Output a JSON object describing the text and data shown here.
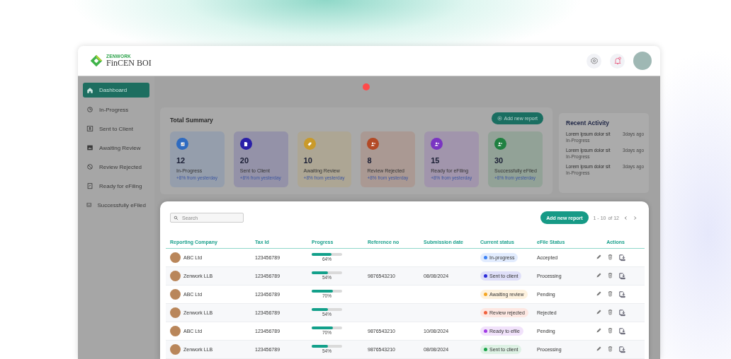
{
  "header": {
    "brand_tagline": "ZENWORK",
    "brand_name": "FinCEN BOI"
  },
  "sidebar": {
    "items": [
      {
        "label": "Dashboard",
        "selected": true
      },
      {
        "label": "In-Progress",
        "selected": false
      },
      {
        "label": "Sent to Client",
        "selected": false
      },
      {
        "label": "Awaiting Review",
        "selected": false
      },
      {
        "label": "Review Rejected",
        "selected": false
      },
      {
        "label": "Ready for eFiling",
        "selected": false
      },
      {
        "label": "Successfully eFiled",
        "selected": false
      }
    ]
  },
  "summary": {
    "title": "Total Summary",
    "add_button": "Add new report",
    "cards": [
      {
        "count": "12",
        "label": "In-Progress",
        "note": "+8% from yesterday",
        "color": "#2f6bc0"
      },
      {
        "count": "20",
        "label": "Sent to Client",
        "note": "+8% from yesterday",
        "color": "#2a1fa8"
      },
      {
        "count": "10",
        "label": "Awaiting Review",
        "note": "+8% from yesterday",
        "color": "#c99a2a"
      },
      {
        "count": "8",
        "label": "Review Rejected",
        "note": "+8% from yesterday",
        "color": "#b34a26"
      },
      {
        "count": "15",
        "label": "Ready for eFiling",
        "note": "+8% from yesterday",
        "color": "#7a34c2"
      },
      {
        "count": "30",
        "label": "Successfully eFiled",
        "note": "+8% from yesterday",
        "color": "#1f8040"
      }
    ]
  },
  "recent_activity": {
    "title": "Recent Activity",
    "items": [
      {
        "title": "Lorem Ipsum dolor sit",
        "status": "In-Progress",
        "time": "3days ago"
      },
      {
        "title": "Lorem Ipsum dolor sit",
        "status": "In-Progress",
        "time": "3days ago"
      },
      {
        "title": "Lorem Ipsum dolor sit",
        "status": "In-Progress",
        "time": "3days ago"
      }
    ]
  },
  "reports": {
    "search": {
      "placeholder": "Search"
    },
    "add_button": "Add new report",
    "range": "1 - 10",
    "total": "of 12",
    "columns": [
      "Reporting Company",
      "Tax Id",
      "Progress",
      "Reference no",
      "Submission date",
      "Current status",
      "eFile Status",
      "Actions"
    ],
    "rows": [
      {
        "company": "ABC Ltd",
        "tax_id": "123456789",
        "level": 0.64,
        "progress": "64%",
        "reference": "",
        "date": "",
        "status": {
          "label": "In-progress",
          "color": "#3b82f6"
        },
        "efile": "Accepted"
      },
      {
        "company": "Zenwork LLB",
        "tax_id": "123456789",
        "level": 0.54,
        "progress": "54%",
        "reference": "9876543210",
        "date": "08/08/2024",
        "status": {
          "label": "Sent to client",
          "color": "#2b2bd9"
        },
        "efile": "Processing"
      },
      {
        "company": "ABC Ltd",
        "tax_id": "123456789",
        "level": 0.7,
        "progress": "70%",
        "reference": "",
        "date": "",
        "status": {
          "label": "Awaiting review",
          "color": "#f5a623"
        },
        "efile": "Pending"
      },
      {
        "company": "Zenwork LLB",
        "tax_id": "123456789",
        "level": 0.54,
        "progress": "54%",
        "reference": "",
        "date": "",
        "status": {
          "label": "Review rejected",
          "color": "#f0603c"
        },
        "efile": "Rejected"
      },
      {
        "company": "ABC Ltd",
        "tax_id": "123456789",
        "level": 0.7,
        "progress": "70%",
        "reference": "9876543210",
        "date": "10/08/2024",
        "status": {
          "label": "Ready to efile",
          "color": "#a23be6"
        },
        "efile": "Pending"
      },
      {
        "company": "Zenwork LLB",
        "tax_id": "123456789",
        "level": 0.54,
        "progress": "54%",
        "reference": "9876543210",
        "date": "08/08/2024",
        "status": {
          "label": "Sent to client",
          "color": "#1aa34a"
        },
        "efile": "Processing"
      }
    ]
  }
}
